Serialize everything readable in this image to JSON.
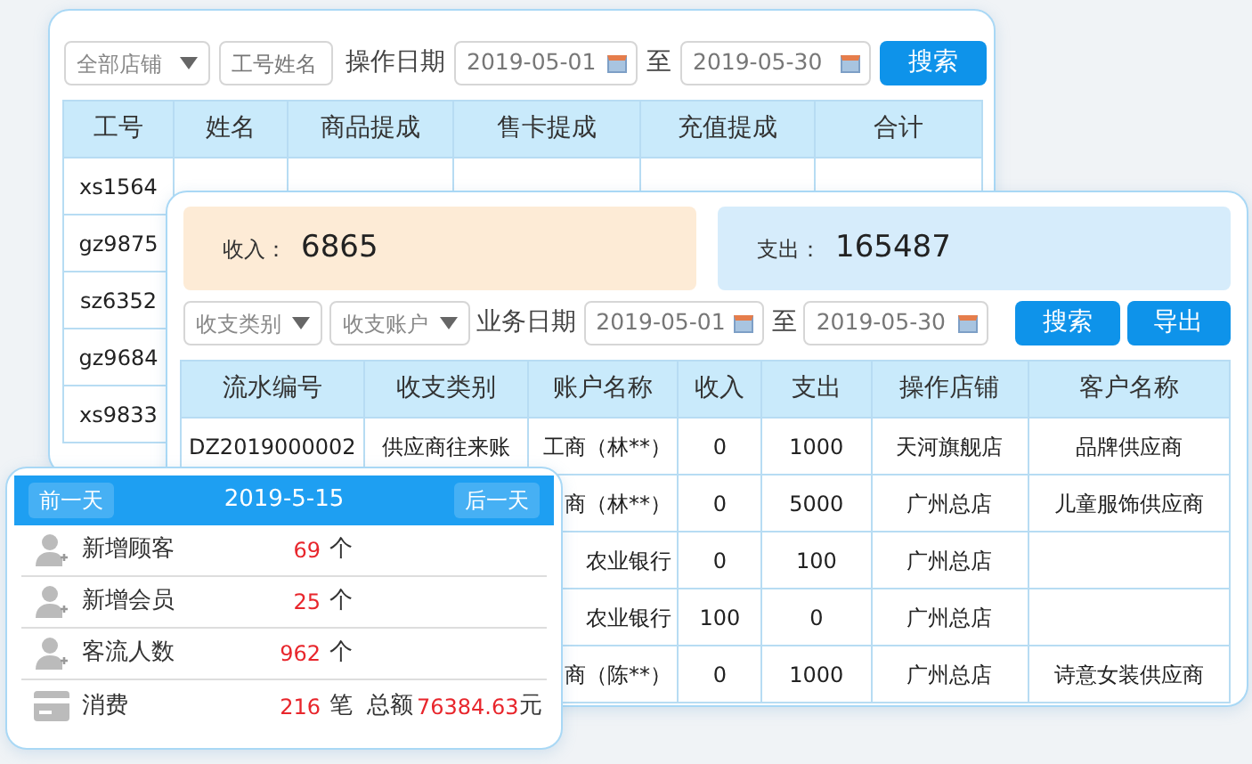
{
  "commission_panel": {
    "filters": {
      "store_select": "全部店铺",
      "staff_placeholder": "工号姓名",
      "date_label": "操作日期",
      "date_from": "2019-05-01",
      "to_label": "至",
      "date_to": "2019-05-30",
      "search_button": "搜索"
    },
    "table": {
      "columns": [
        "工号",
        "姓名",
        "商品提成",
        "售卡提成",
        "充值提成",
        "合计"
      ],
      "rows": [
        [
          "xs1564"
        ],
        [
          "gz9875"
        ],
        [
          "sz6352"
        ],
        [
          "gz9684"
        ],
        [
          "xs9833"
        ]
      ]
    }
  },
  "ledger_panel": {
    "summary": [
      {
        "label": "收入：",
        "value": "6865",
        "kind": "income"
      },
      {
        "label": "支出：",
        "value": "165487",
        "kind": "expense"
      }
    ],
    "filters": {
      "category_select": "收支类别",
      "account_select": "收支账户",
      "date_label": "业务日期",
      "date_from": "2019-05-01",
      "to_label": "至",
      "date_to": "2019-05-30",
      "buttons": [
        "搜索",
        "导出"
      ]
    },
    "table": {
      "columns": [
        "流水编号",
        "收支类别",
        "账户名称",
        "收入",
        "支出",
        "操作店铺",
        "客户名称"
      ],
      "rows": [
        [
          "DZ2019000002",
          "供应商往来账",
          "工商（林**）",
          "0",
          "1000",
          "天河旗舰店",
          "品牌供应商"
        ],
        [
          null,
          null,
          "商（林**）",
          "0",
          "5000",
          "广州总店",
          "儿童服饰供应商"
        ],
        [
          null,
          null,
          "农业银行",
          "0",
          "100",
          "广州总店"
        ],
        [
          null,
          null,
          "农业银行",
          "100",
          "0",
          "广州总店"
        ],
        [
          null,
          null,
          "商（陈**）",
          "0",
          "1000",
          "广州总店",
          "诗意女装供应商"
        ]
      ]
    }
  },
  "daily_panel": {
    "prev_button": "前一天",
    "date": "2019-5-15",
    "next_button": "后一天",
    "rows": [
      {
        "kind": "user",
        "label": "新增顾客",
        "count": "69",
        "unit": "个"
      },
      {
        "kind": "user",
        "label": "新增会员",
        "count": "25",
        "unit": "个"
      },
      {
        "kind": "user",
        "label": "客流人数",
        "count": "962",
        "unit": "个"
      },
      {
        "kind": "card",
        "label": "消费",
        "count": "216",
        "unit": "笔",
        "total_label": "总额",
        "total": "76384.63",
        "total_unit": "元"
      }
    ]
  }
}
